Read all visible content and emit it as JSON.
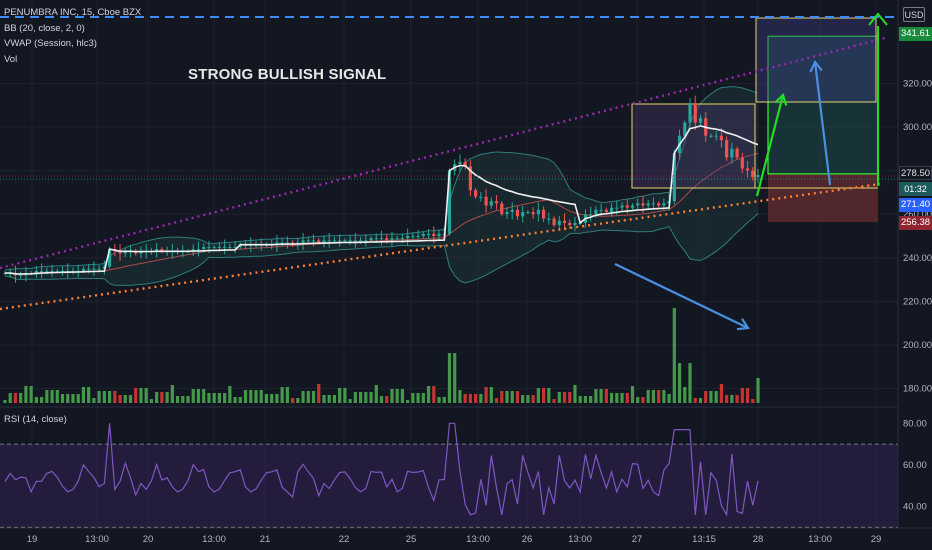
{
  "legend": {
    "symbol": "PENUMBRA INC, 15, Cboe BZX",
    "bb": "BB (20, close, 2, 0)",
    "vwap": "VWAP (Session, hlc3)",
    "vol": "Vol"
  },
  "rsi_legend": "RSI (14, close)",
  "annotation": "STRONG BULLISH SIGNAL",
  "currency": "USD",
  "price_tags": {
    "target": "341.61",
    "current": "278.50",
    "countdown": "01:32",
    "entry": "271.40",
    "stop": "256.38"
  },
  "colors": {
    "background": "#131722",
    "up": "#26a69a",
    "down": "#ef5350",
    "volume_up": "#4caf50",
    "volume_down": "#e53935",
    "bb_fill": "#1e3b3b",
    "purple_trendline": "#9c27b0",
    "orange_trendline": "#ff7f32",
    "arrow_blue": "#4a90e2",
    "arrow_green": "#22dd22",
    "target_zone": "#1b4a4a",
    "stop_zone": "#5a2a2e",
    "rsi": "#7e57c2"
  },
  "chart_data": {
    "type": "candlestick",
    "price_axis": {
      "ticks": [
        "320.00",
        "300.00",
        "280.00",
        "260.00",
        "240.00",
        "220.00",
        "200.00",
        "180.00"
      ],
      "ylim": [
        172,
        344
      ]
    },
    "rsi_axis": {
      "ticks": [
        "80.00",
        "60.00",
        "40.00"
      ],
      "ylim": [
        28,
        84
      ],
      "bands": [
        70,
        30
      ]
    },
    "x_ticks": [
      "19",
      "13:00",
      "20",
      "13:00",
      "21",
      "22",
      "25",
      "13:00",
      "26",
      "13:00",
      "27",
      "13:15",
      "28",
      "13:00",
      "29"
    ],
    "close": [
      233,
      233,
      232,
      232,
      233,
      233,
      234,
      234,
      234,
      234,
      234,
      234,
      234,
      234,
      234,
      235,
      235,
      235,
      235,
      236,
      244,
      243,
      242,
      243,
      243,
      242,
      243,
      243,
      243,
      244,
      243,
      243,
      243,
      243,
      243,
      243,
      244,
      244,
      245,
      245,
      245,
      245,
      245,
      245,
      245,
      246,
      246,
      246,
      246,
      246,
      246,
      246,
      247,
      247,
      247,
      246,
      247,
      248,
      248,
      248,
      247,
      248,
      248,
      248,
      248,
      248,
      248,
      248,
      248,
      248,
      249,
      249,
      249,
      248,
      249,
      249,
      249,
      250,
      250,
      250,
      251,
      251,
      250,
      251,
      251,
      280,
      283,
      284,
      282,
      271,
      268,
      268,
      264,
      266,
      265,
      260,
      261,
      262,
      259,
      261,
      261,
      260,
      262,
      258,
      258,
      255,
      257,
      256,
      255,
      256,
      256,
      260,
      260,
      262,
      262,
      261,
      263,
      263,
      264,
      263,
      264,
      265,
      264,
      265,
      265,
      264,
      265,
      266,
      288,
      296,
      302,
      311,
      302,
      304,
      296,
      296,
      296,
      294,
      286,
      290,
      286,
      281,
      280,
      277,
      278
    ]
  }
}
